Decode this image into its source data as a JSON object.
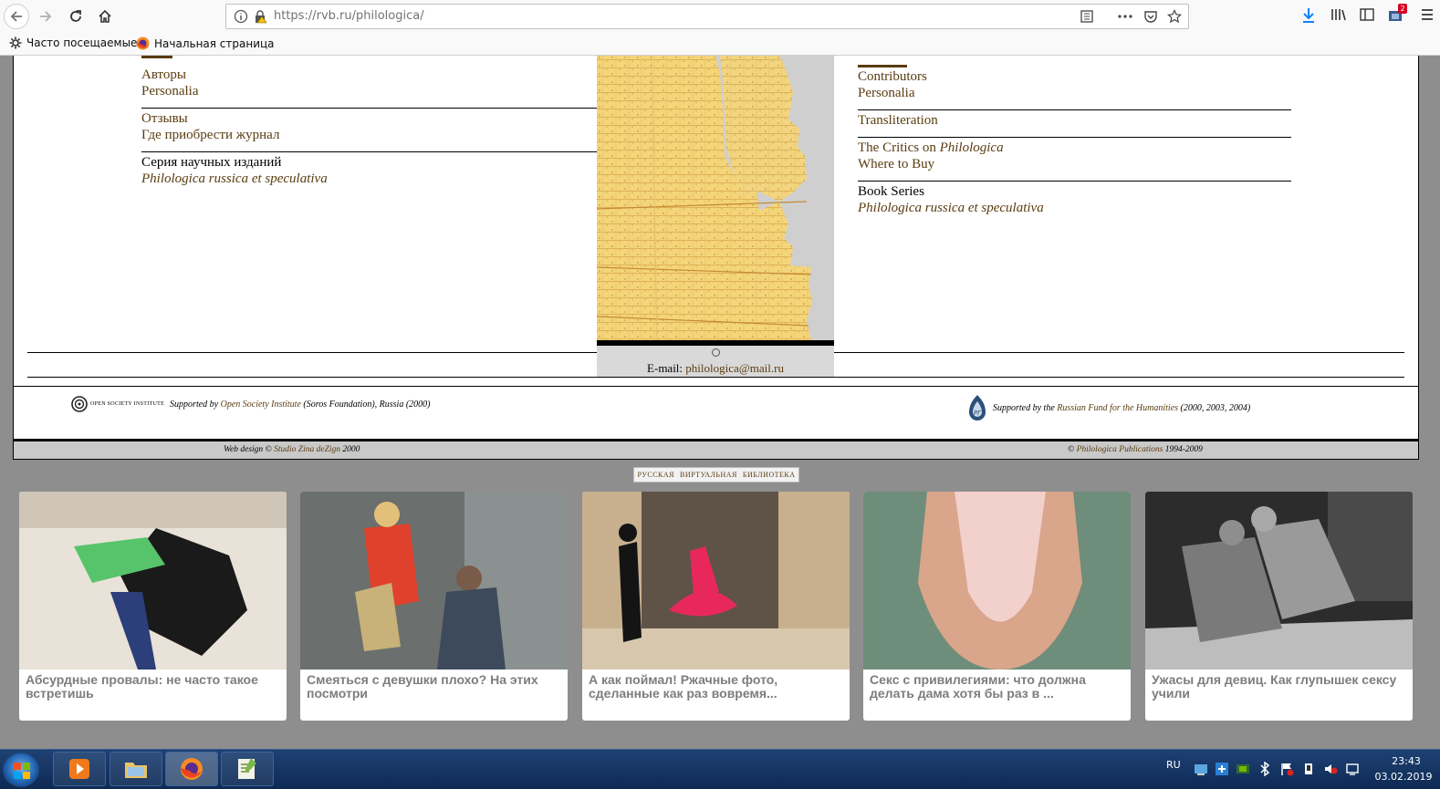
{
  "browser": {
    "url_host": "https://rvb.ru",
    "url_path": "/philologica/",
    "bookmarks": [
      "Часто посещаемые",
      "Начальная страница"
    ],
    "notification_count": "2"
  },
  "left_menu": {
    "group1": [
      "Авторы",
      "Personalia"
    ],
    "group2": [
      "Отзывы",
      "Где приобрести журнал"
    ],
    "series_title": "Серия научных изданий",
    "series_link": "Philologica russica et speculativa"
  },
  "right_menu": {
    "group1": [
      "Contributors",
      "Personalia"
    ],
    "transliteration": "Transliteration",
    "critics_prefix": "The Critics on ",
    "critics_italic": "Philologica",
    "where_to_buy": "Where to Buy",
    "series_title": "Book Series",
    "series_link": "Philologica russica et speculativa"
  },
  "email": {
    "label": "E-mail: ",
    "address": "philologica@mail.ru"
  },
  "support": {
    "left_logo_text": "OPEN SOCIETY INSTITUTE",
    "left_prefix": "Supported by ",
    "left_link": "Open Society Institute",
    "left_suffix": " (Soros Foundation), Russia (2000)",
    "right_prefix": "Supported by the ",
    "right_link": "Russian Fund for the Humanities",
    "right_suffix": " (2000, 2003, 2004)"
  },
  "footer": {
    "design_prefix": "Web design © ",
    "design_link": "Studio Zina deZign",
    "design_year": " 2000",
    "copy_prefix": "© ",
    "copy_link": "Philologica Publications",
    "copy_years": " 1994-2009"
  },
  "rvb_badge": [
    "РУССКАЯ",
    "ВИРТУАЛЬНАЯ",
    "БИБЛИОТЕКА"
  ],
  "ads": [
    {
      "caption": "Абсурдные провалы: не часто такое встретишь",
      "palette": [
        "#e8e2d8",
        "#1a1a1a",
        "#57c46b"
      ]
    },
    {
      "caption": "Смеяться с девушки плохо? На этих посмотри",
      "palette": [
        "#6b6f6e",
        "#e0412c",
        "#c9b27a"
      ]
    },
    {
      "caption": "А как поймал! Ржачные фото, сделанные как раз вовремя...",
      "palette": [
        "#c8b08e",
        "#e8285a",
        "#5f5348"
      ]
    },
    {
      "caption": "Секс с привилегиями: что должна делать дама хотя бы раз в ...",
      "palette": [
        "#6e8d7a",
        "#d9a58b",
        "#f2d0cc"
      ]
    },
    {
      "caption": "Ужасы для девиц. Как глупышек сексу учили",
      "palette": [
        "#2c2c2c",
        "#bdbdbd",
        "#7a7a7a"
      ]
    }
  ],
  "taskbar": {
    "lang": "RU",
    "time": "23:43",
    "date": "03.02.2019"
  }
}
